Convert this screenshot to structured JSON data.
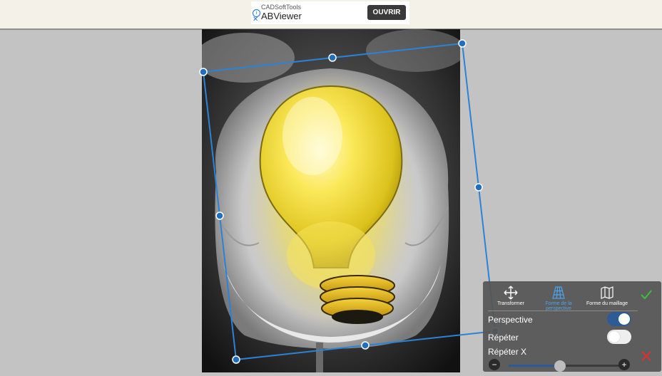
{
  "ad": {
    "company": "CADSoftTools",
    "title": "ABViewer",
    "cta": "OUVRIR"
  },
  "canvas": {
    "image": "lightbulb-in-flower",
    "transform": "perspective"
  },
  "panel": {
    "modes": [
      {
        "label": "Transformer",
        "icon": "move-arrows-icon",
        "active": false
      },
      {
        "label": "Forme de la perspective",
        "icon": "perspective-grid-icon",
        "active": true
      },
      {
        "label": "Forme du maillage",
        "icon": "mesh-map-icon",
        "active": false
      }
    ],
    "perspective_label": "Perspective",
    "perspective_on": true,
    "repeat_label": "Répéter",
    "repeat_on": false,
    "repeat_x_label": "Répéter X",
    "repeat_x_value": 0.45,
    "colors": {
      "accent": "#4ca3ee",
      "confirm": "#3cbf3c",
      "cancel": "#e03030",
      "toggle_on": "#2e5a96"
    }
  }
}
